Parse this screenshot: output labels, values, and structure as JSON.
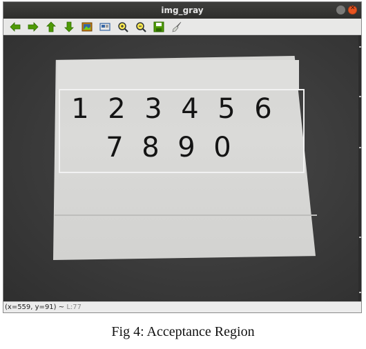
{
  "window": {
    "title": "img_gray"
  },
  "toolbar": {
    "buttons": [
      {
        "icon": "arrow-left-icon"
      },
      {
        "icon": "arrow-right-icon"
      },
      {
        "icon": "arrow-up-icon"
      },
      {
        "icon": "arrow-down-icon"
      },
      {
        "icon": "image-icon"
      },
      {
        "icon": "properties-icon"
      },
      {
        "icon": "zoom-in-icon"
      },
      {
        "icon": "zoom-out-icon"
      },
      {
        "icon": "save-icon"
      },
      {
        "icon": "brush-icon"
      }
    ]
  },
  "image": {
    "row1_digits": [
      "1",
      "2",
      "3",
      "4",
      "5",
      "6"
    ],
    "row2_digits": [
      "7",
      "8",
      "9",
      "0"
    ]
  },
  "status": {
    "coords": "(x=559, y=91) ~",
    "level": "L:77"
  },
  "caption": "Fig 4: Acceptance Region"
}
